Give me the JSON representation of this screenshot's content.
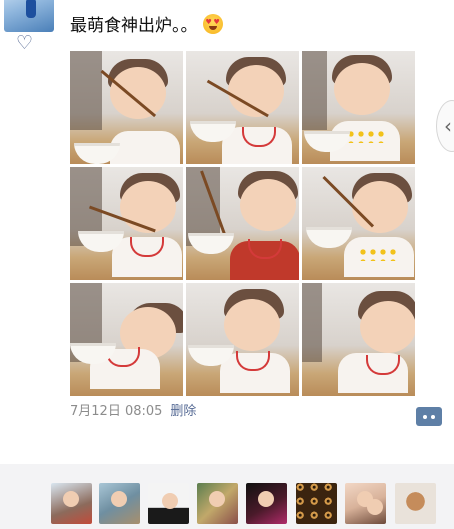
{
  "post": {
    "text": "最萌食神出炉。。",
    "emoji_icon": "heart-eyes-emoji-icon",
    "photos": [
      {
        "label": "photo-1"
      },
      {
        "label": "photo-2"
      },
      {
        "label": "photo-3"
      },
      {
        "label": "photo-4"
      },
      {
        "label": "photo-5"
      },
      {
        "label": "photo-6"
      },
      {
        "label": "photo-7"
      },
      {
        "label": "photo-8"
      },
      {
        "label": "photo-9"
      }
    ],
    "timestamp": "7月12日 08:05",
    "delete_label": "删除",
    "comment_icon": "comment-bubble-icon"
  },
  "likes": {
    "icon": "heart-outline-icon",
    "heart_glyph": "♡",
    "liker_count": 8
  },
  "colors": {
    "link_blue": "#576b95",
    "meta_gray": "#8c8c8c",
    "likes_bg": "#f3f3f5"
  }
}
